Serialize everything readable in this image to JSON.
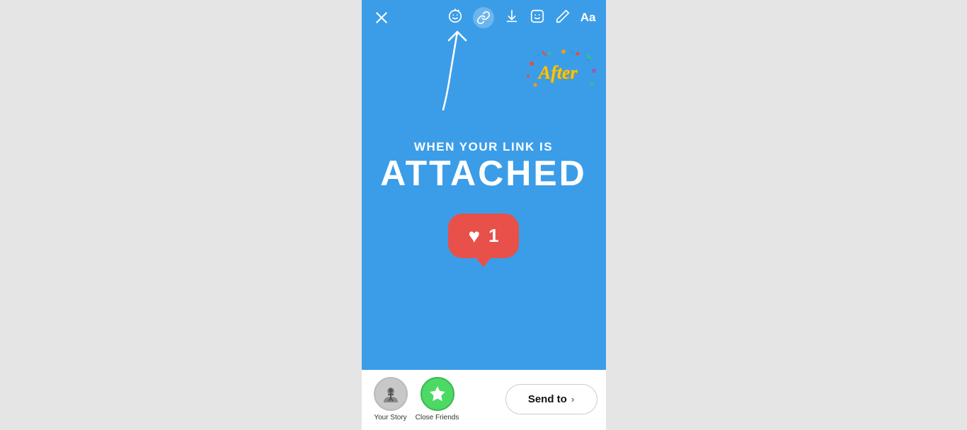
{
  "toolbar": {
    "close_label": "✕",
    "aa_label": "Aa"
  },
  "story": {
    "subtitle": "WHEN YOUR LINK IS",
    "title": "ATTACHED",
    "like_count": "1",
    "after_sticker": "After"
  },
  "bottom": {
    "your_story_label": "Your Story",
    "close_friends_label": "Close Friends",
    "send_to_label": "Send to"
  },
  "colors": {
    "background": "#3b9de8",
    "like_bg": "#e8504a",
    "close_friends_bg": "#4cd964",
    "send_to_border": "#cccccc"
  }
}
